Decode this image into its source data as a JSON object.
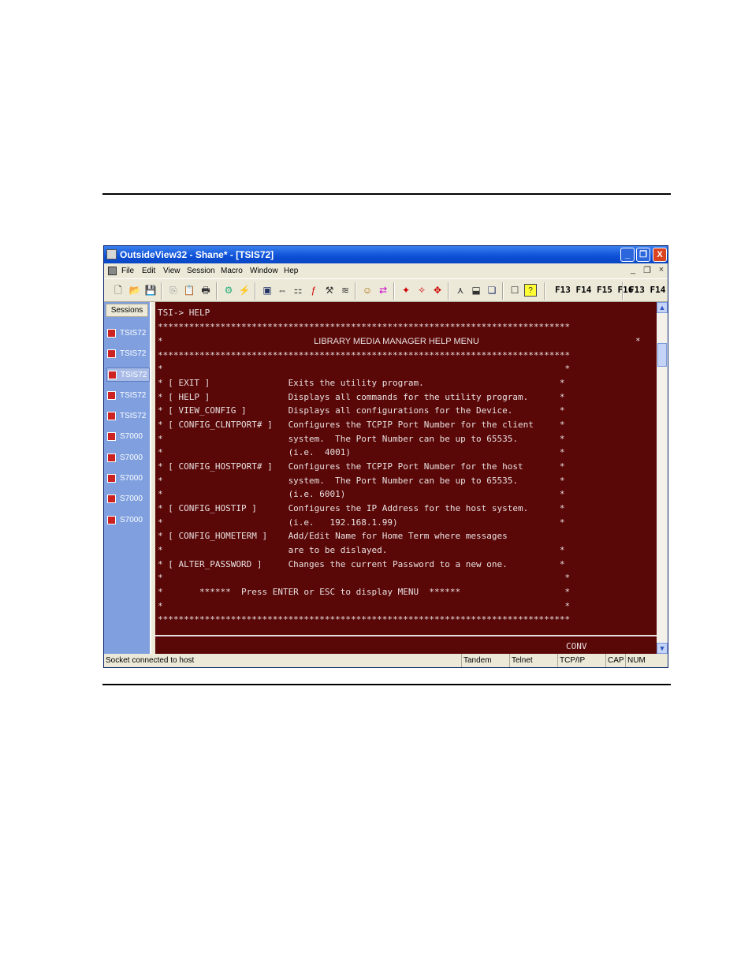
{
  "window": {
    "title": "OutsideView32 - Shane* - [TSIS72]",
    "minimize": "_",
    "restore": "❐",
    "close": "X"
  },
  "menu": {
    "items": [
      "File",
      "Edit",
      "View",
      "Session",
      "Macro",
      "Window",
      "Hep"
    ],
    "mdi_min": "_",
    "mdi_restore": "❐",
    "mdi_close": "×"
  },
  "toolbar": {
    "fkeys_a": "F13 F14 F15 F16",
    "fkeys_b": "F13 F14"
  },
  "sessions": {
    "header": "Sessions",
    "items": [
      "TSIS72",
      "TSIS72",
      "TSIS72",
      "TSIS72",
      "TSIS72",
      "S7000",
      "S7000",
      "S7000",
      "S7000",
      "S7000"
    ],
    "selected_index": 2
  },
  "terminal": {
    "prompt": "TSI-> HELP",
    "stars": "*******************************************************************************",
    "title": "LIBRARY MEDIA MANAGER HELP MENU",
    "lines": [
      "*                                                                             *",
      "* [ EXIT ]               Exits the utility program.                          *",
      "* [ HELP ]               Displays all commands for the utility program.      *",
      "* [ VIEW_CONFIG ]        Displays all configurations for the Device.         *",
      "* [ CONFIG_CLNTPORT# ]   Configures the TCPIP Port Number for the client     *",
      "*                        system.  The Port Number can be up to 65535.        *",
      "*                        (i.e.  4001)                                        *",
      "* [ CONFIG_HOSTPORT# ]   Configures the TCPIP Port Number for the host       *",
      "*                        system.  The Port Number can be up to 65535.        *",
      "*                        (i.e. 6001)                                         *",
      "* [ CONFIG_HOSTIP ]      Configures the IP Address for the host system.      *",
      "*                        (i.e.   192.168.1.99)                               *",
      "* [ CONFIG_HOMETERM ]    Add/Edit Name for Home Term where messages",
      "*                        are to be dislayed.                                 *",
      "* [ ALTER_PASSWORD ]     Changes the current Password to a new one.          *",
      "*                                                                             *",
      "*       ******  Press ENTER or ESC to display MENU  ******                    *",
      "*                                                                             *"
    ],
    "bottom_label": "CONV"
  },
  "status": {
    "message": "Socket connected to host",
    "fields": [
      "Tandem",
      "Telnet",
      "TCP/IP",
      "CAP",
      "NUM"
    ]
  }
}
